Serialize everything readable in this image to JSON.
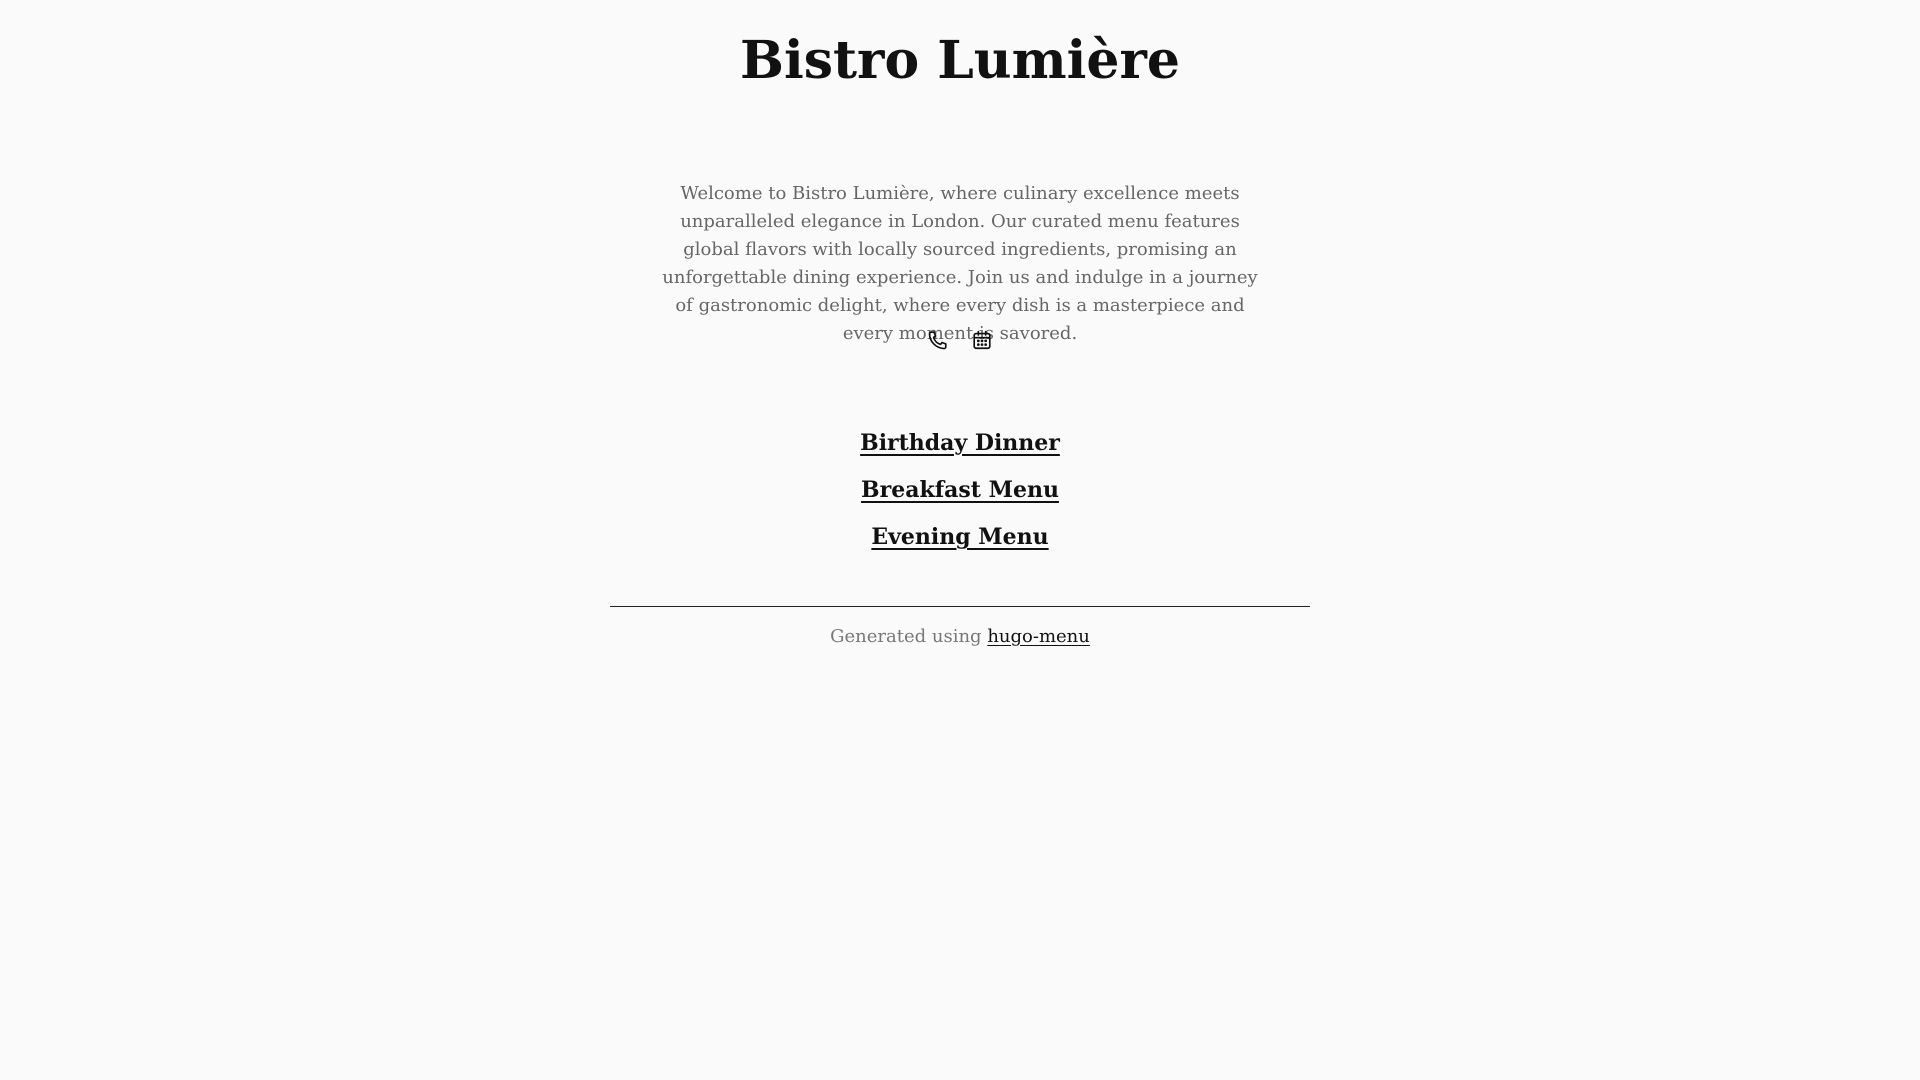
{
  "header": {
    "title": "Bistro Lumière"
  },
  "intro": {
    "text": "Welcome to Bistro Lumière, where culinary excellence meets unparalleled elegance in London. Our curated menu features global flavors with locally sourced ingredients, promising an unforgettable dining experience. Join us and indulge in a journey of gastronomic delight, where every dish is a masterpiece and every moment is savored."
  },
  "contact": {
    "icons": [
      "phone-icon",
      "calendar-icon"
    ]
  },
  "menus": [
    {
      "label": "Birthday Dinner"
    },
    {
      "label": "Breakfast Menu"
    },
    {
      "label": "Evening Menu"
    }
  ],
  "footer": {
    "prefix": "Generated using",
    "link_label": "hugo-menu"
  },
  "colors": {
    "background": "#fafafa",
    "text": "#111111",
    "muted": "#666666"
  }
}
